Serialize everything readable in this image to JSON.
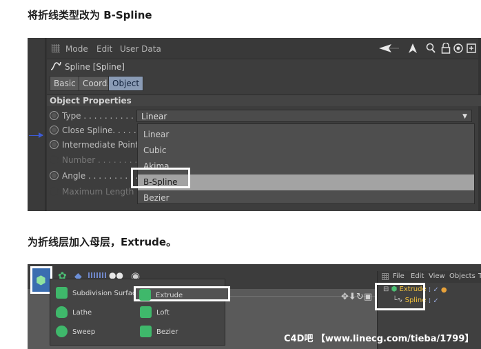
{
  "captions": {
    "step1": "将折线类型改为 B-Spline",
    "step2": "为折线层加入母层，Extrude。"
  },
  "attributes": {
    "menu": [
      "Mode",
      "Edit",
      "User Data"
    ],
    "toolbar_icons": [
      "arrow-left-icon",
      "arrow-up-icon",
      "search-icon",
      "lock-icon",
      "target-icon",
      "new-panel-icon"
    ],
    "object_name": "Spline [Spline]",
    "tabs": [
      "Basic",
      "Coord.",
      "Object"
    ],
    "active_tab": "Object",
    "section_title": "Object Properties",
    "properties": [
      {
        "label": "Type . . . . . . . . . . . . . ."
      },
      {
        "label": "Close Spline. . . . . . . ."
      },
      {
        "label": "Intermediate Points"
      },
      {
        "label": "Number . . . . . . . . . ."
      },
      {
        "label": "Angle . . . . . . . . . . . . ."
      },
      {
        "label": "Maximum Length"
      }
    ],
    "type_value": "Linear",
    "type_options": [
      "Linear",
      "Cubic",
      "Akima",
      "B-Spline",
      "Bezier"
    ],
    "selected_option": "B-Spline"
  },
  "generators_menu": {
    "left_column": [
      "Subdivision Surface",
      "Lathe",
      "Sweep"
    ],
    "right_column": [
      "Extrude",
      "Loft",
      "Bezier"
    ],
    "highlighted": "Extrude"
  },
  "object_manager": {
    "menu": [
      "File",
      "Edit",
      "View",
      "Objects",
      "T"
    ],
    "tree": [
      "Extrude",
      "Spline"
    ]
  },
  "watermark": "C4D吧 【www.linecg.com/tieba/1799】",
  "colors": {
    "highlight_border": "#ffffff",
    "selected_option_bg": "#a3a3a3",
    "active_tab_bg": "#8a9bb5",
    "tree_label": "#f3c23d",
    "generator_green": "#3fb86b"
  }
}
